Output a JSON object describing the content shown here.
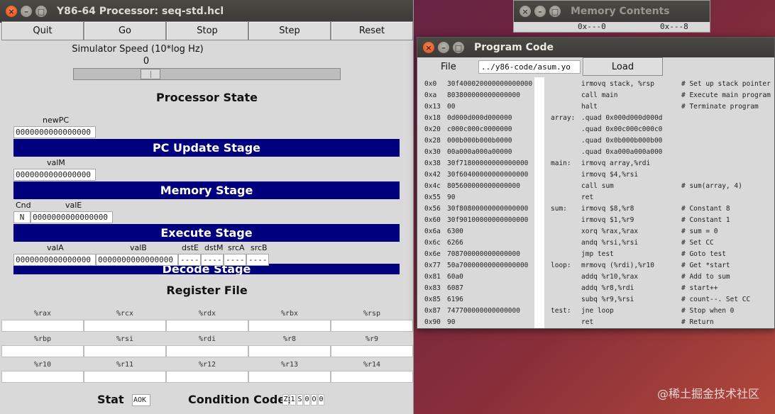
{
  "main_window": {
    "title": "Y86-64 Processor: seq-std.hcl",
    "buttons": {
      "quit": "Quit",
      "go": "Go",
      "stop": "Stop",
      "step": "Step",
      "reset": "Reset"
    },
    "speed": {
      "label": "Simulator Speed (10*log Hz)",
      "value": "0",
      "level_fraction": 0.27
    },
    "processor_state_title": "Processor State",
    "pc_update": {
      "label": "newPC",
      "value": "0000000000000000",
      "stage": "PC Update Stage"
    },
    "memory": {
      "label": "valM",
      "value": "0000000000000000",
      "stage": "Memory Stage"
    },
    "execute": {
      "cnd_label": "Cnd",
      "cnd_value": "N",
      "vale_label": "valE",
      "vale_value": "0000000000000000",
      "stage": "Execute Stage"
    },
    "decode": {
      "stage": "Decode Stage",
      "vala_label": "valA",
      "vala_value": "0000000000000000",
      "valb_label": "valB",
      "valb_value": "0000000000000000",
      "dste_label": "dstE",
      "dste_value": "----",
      "dstm_label": "dstM",
      "dstm_value": "----",
      "srca_label": "srcA",
      "srca_value": "----",
      "srcb_label": "srcB",
      "srcb_value": "----"
    },
    "register_file": {
      "title": "Register File",
      "rows": [
        [
          "%rax",
          "%rcx",
          "%rdx",
          "%rbx",
          "%rsp"
        ],
        [
          "%rbp",
          "%rsi",
          "%rdi",
          "%r8",
          "%r9"
        ],
        [
          "%r10",
          "%r11",
          "%r12",
          "%r13",
          "%r14"
        ]
      ]
    },
    "stat": {
      "label": "Stat",
      "value": "AOK"
    },
    "condition_codes": {
      "label": "Condition Codes",
      "flags": [
        "Z",
        "1",
        "S",
        "0",
        "O",
        "0"
      ]
    }
  },
  "memory_window": {
    "title": "Memory Contents",
    "columns": [
      "0x---0",
      "0x---8"
    ]
  },
  "program_window": {
    "title": "Program Code",
    "file_label": "File",
    "file_value": "../y86-code/asum.yo",
    "load_label": "Load",
    "lines": [
      {
        "addr": "0x0",
        "hex": "30f400020000000000000",
        "label": "",
        "instr": "irmovq stack, %rsp",
        "comment": "# Set up stack pointer"
      },
      {
        "addr": "0xa",
        "hex": "803800000000000000",
        "label": "",
        "instr": "call main",
        "comment": "# Execute main program"
      },
      {
        "addr": "0x13",
        "hex": "00",
        "label": "",
        "instr": "halt",
        "comment": "# Terminate program"
      },
      {
        "addr": "0x18",
        "hex": "0d000d000d000000",
        "label": "array:",
        "instr": ".quad 0x000d000d000d",
        "comment": ""
      },
      {
        "addr": "0x20",
        "hex": "c000c000c0000000",
        "label": "",
        "instr": ".quad 0x00c000c000c0",
        "comment": ""
      },
      {
        "addr": "0x28",
        "hex": "000b000b000b0000",
        "label": "",
        "instr": ".quad 0x0b000b000b00",
        "comment": ""
      },
      {
        "addr": "0x30",
        "hex": "00a000a000a00000",
        "label": "",
        "instr": ".quad 0xa000a000a000",
        "comment": ""
      },
      {
        "addr": "0x38",
        "hex": "30f71800000000000000",
        "label": "main:",
        "instr": "irmovq array,%rdi",
        "comment": ""
      },
      {
        "addr": "0x42",
        "hex": "30f60400000000000000",
        "label": "",
        "instr": "irmovq $4,%rsi",
        "comment": ""
      },
      {
        "addr": "0x4c",
        "hex": "805600000000000000",
        "label": "",
        "instr": "call sum",
        "comment": "# sum(array, 4)"
      },
      {
        "addr": "0x55",
        "hex": "90",
        "label": "",
        "instr": "ret",
        "comment": ""
      },
      {
        "addr": "0x56",
        "hex": "30f80800000000000000",
        "label": "sum:",
        "instr": "irmovq $8,%r8",
        "comment": "# Constant 8"
      },
      {
        "addr": "0x60",
        "hex": "30f90100000000000000",
        "label": "",
        "instr": "irmovq $1,%r9",
        "comment": "# Constant 1"
      },
      {
        "addr": "0x6a",
        "hex": "6300",
        "label": "",
        "instr": "xorq %rax,%rax",
        "comment": "# sum = 0"
      },
      {
        "addr": "0x6c",
        "hex": "6266",
        "label": "",
        "instr": "andq %rsi,%rsi",
        "comment": "# Set CC"
      },
      {
        "addr": "0x6e",
        "hex": "708700000000000000",
        "label": "",
        "instr": "jmp     test",
        "comment": "# Goto test"
      },
      {
        "addr": "0x77",
        "hex": "50a70000000000000000",
        "label": "loop:",
        "instr": "mrmovq (%rdi),%r10",
        "comment": "# Get *start"
      },
      {
        "addr": "0x81",
        "hex": "60a0",
        "label": "",
        "instr": "addq %r10,%rax",
        "comment": "# Add to sum"
      },
      {
        "addr": "0x83",
        "hex": "6087",
        "label": "",
        "instr": "addq %r8,%rdi",
        "comment": "# start++"
      },
      {
        "addr": "0x85",
        "hex": "6196",
        "label": "",
        "instr": "subq %r9,%rsi",
        "comment": "# count--.  Set CC"
      },
      {
        "addr": "0x87",
        "hex": "747700000000000000",
        "label": "test:",
        "instr": "jne    loop",
        "comment": "# Stop when 0"
      },
      {
        "addr": "0x90",
        "hex": "90",
        "label": "",
        "instr": "ret",
        "comment": "# Return"
      }
    ]
  },
  "watermark": "@稀土掘金技术社区"
}
